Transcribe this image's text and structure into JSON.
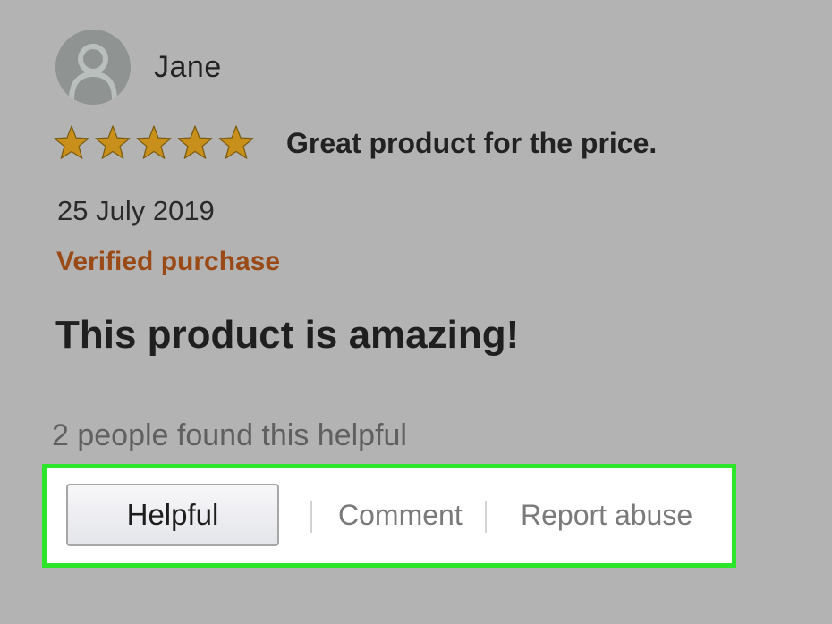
{
  "reviewer": {
    "name": "Jane",
    "avatar_icon": "user-silhouette-icon"
  },
  "rating": {
    "stars": 5,
    "max_stars": 5,
    "star_color": "#c8901b",
    "title": "Great product for the price."
  },
  "date": "25 July 2019",
  "verified_label": "Verified purchase",
  "verified_color": "#9a4a16",
  "body": "This product is amazing!",
  "helpful_count_text": "2 people found this helpful",
  "actions": {
    "helpful_label": "Helpful",
    "comment_label": "Comment",
    "report_label": "Report abuse",
    "highlight_color": "#2de62b"
  }
}
